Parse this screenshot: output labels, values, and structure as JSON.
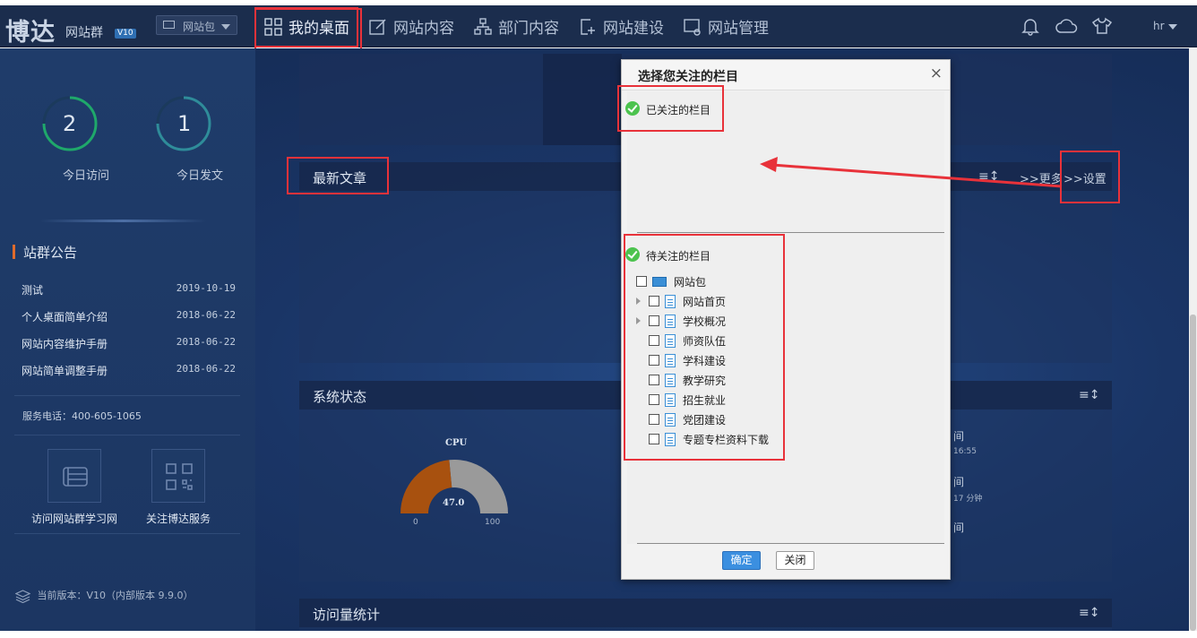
{
  "header": {
    "logo": "博达",
    "logo_sub": "网站群",
    "logo_badge": "V10",
    "site_select": "网站包",
    "nav": [
      {
        "label": "我的桌面",
        "icon": "grid-icon"
      },
      {
        "label": "网站内容",
        "icon": "edit-icon"
      },
      {
        "label": "部门内容",
        "icon": "org-icon"
      },
      {
        "label": "网站建设",
        "icon": "add-page-icon"
      },
      {
        "label": "网站管理",
        "icon": "settings-screen-icon"
      }
    ],
    "user": "hr"
  },
  "sidebar": {
    "stats": [
      {
        "value": "2",
        "label": "今日访问",
        "color": "#1fa86b"
      },
      {
        "value": "1",
        "label": "今日发文",
        "color": "#2f8c9a"
      }
    ],
    "announcement_title": "站群公告",
    "announcements": [
      {
        "title": "测试",
        "date": "2019-10-19"
      },
      {
        "title": "个人桌面简单介绍",
        "date": "2018-06-22"
      },
      {
        "title": "网站内容维护手册",
        "date": "2018-06-22"
      },
      {
        "title": "网站简单调整手册",
        "date": "2018-06-22"
      }
    ],
    "phone": "服务电话：400-605-1065",
    "tiles": [
      {
        "label": "访问网站群学习网",
        "icon": "book-icon"
      },
      {
        "label": "关注博达服务",
        "icon": "qrcode-icon"
      }
    ],
    "version": "当前版本：V10（内部版本 9.9.0）"
  },
  "panels": {
    "latest_title": "最新文章",
    "more": ">>更多",
    "settings": ">>设置",
    "system_title": "系统状态",
    "cpu_label": "CPU",
    "cpu_value": "47.0",
    "cpu_min": "0",
    "cpu_max": "100",
    "side_partial": [
      {
        "label": "间",
        "sub": "16:55"
      },
      {
        "label": "间",
        "sub": "17 分钟"
      },
      {
        "label": "间",
        "sub": ""
      }
    ],
    "visits_title": "访问量统计"
  },
  "modal": {
    "title": "选择您关注的栏目",
    "close": "×",
    "followed_label": "已关注的栏目",
    "pending_label": "待关注的栏目",
    "tree_root": "网站包",
    "tree_items": [
      {
        "label": "网站首页",
        "expandable": true
      },
      {
        "label": "学校概况",
        "expandable": true
      },
      {
        "label": "师资队伍",
        "expandable": false
      },
      {
        "label": "学科建设",
        "expandable": false
      },
      {
        "label": "教学研究",
        "expandable": false
      },
      {
        "label": "招生就业",
        "expandable": false
      },
      {
        "label": "党团建设",
        "expandable": false
      },
      {
        "label": "专题专栏资料下载",
        "expandable": false
      }
    ],
    "ok": "确定",
    "cancel": "关闭"
  },
  "colors": {
    "header_bg": "#1b2d4d",
    "highlight": "#e8323a",
    "gauge_fill": "#a8510f",
    "gauge_rest": "#9a9a9a",
    "primary_button": "#3b8fe0"
  }
}
